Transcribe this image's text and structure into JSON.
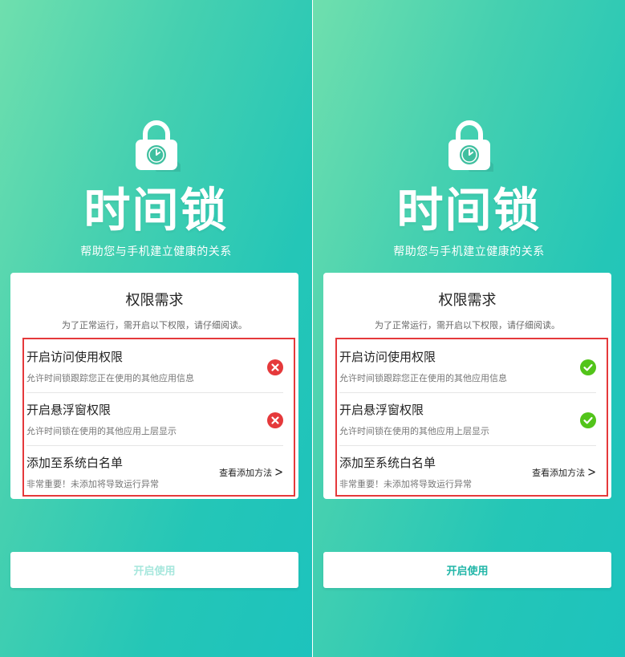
{
  "app": {
    "title": "时间锁",
    "tagline": "帮助您与手机建立健康的关系"
  },
  "card": {
    "title": "权限需求",
    "subtitle": "为了正常运行，需开启以下权限，请仔细阅读。"
  },
  "permissions": [
    {
      "title": "开启访问使用权限",
      "description": "允许时间锁跟踪您正在使用的其他应用信息"
    },
    {
      "title": "开启悬浮窗权限",
      "description": "允许时间锁在使用的其他应用上层显示"
    },
    {
      "title": "添加至系统白名单",
      "description": "非常重要！未添加将导致运行异常",
      "link": "查看添加方法",
      "link_icon": "chevron-right-icon"
    }
  ],
  "screens": [
    {
      "state": "before",
      "status_icon": "error-x-icon",
      "status_color": "#e5393b",
      "button_label": "开启使用",
      "button_enabled": false
    },
    {
      "state": "after",
      "status_icon": "check-icon",
      "status_color": "#52c41a",
      "button_label": "开启使用",
      "button_enabled": true
    }
  ],
  "colors": {
    "gradient_start": "#6fdfae",
    "gradient_end": "#1dc3bd",
    "highlight_border": "#e5393b",
    "button_text_enabled": "#22b6a8",
    "button_text_disabled": "#a7e7dd"
  }
}
